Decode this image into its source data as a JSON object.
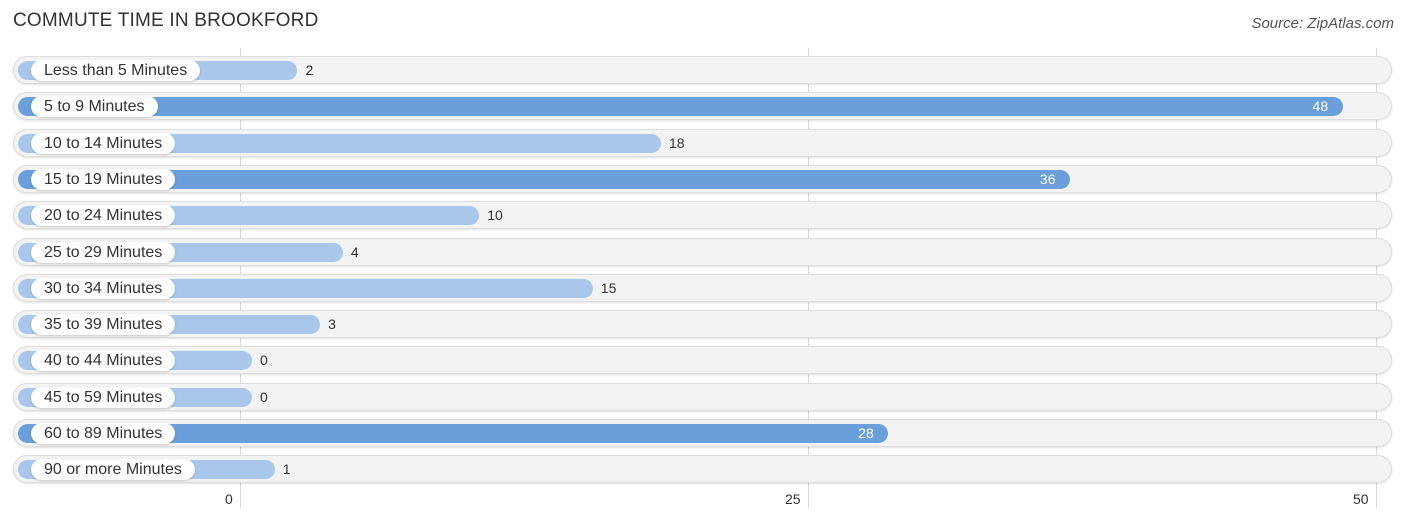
{
  "header": {
    "title": "COMMUTE TIME IN BROOKFORD",
    "source": "Source: ZipAtlas.com"
  },
  "colors": {
    "bar_strong": "#6a9fdb",
    "bar_light": "#a9c7ea",
    "row_bg": "#f3f3f3"
  },
  "chart_data": {
    "type": "bar",
    "orientation": "horizontal",
    "title": "COMMUTE TIME IN BROOKFORD",
    "xlabel": "",
    "ylabel": "",
    "categories": [
      "Less than 5 Minutes",
      "5 to 9 Minutes",
      "10 to 14 Minutes",
      "15 to 19 Minutes",
      "20 to 24 Minutes",
      "25 to 29 Minutes",
      "30 to 34 Minutes",
      "35 to 39 Minutes",
      "40 to 44 Minutes",
      "45 to 59 Minutes",
      "60 to 89 Minutes",
      "90 or more Minutes"
    ],
    "values": [
      2,
      48,
      18,
      36,
      10,
      4,
      15,
      3,
      0,
      0,
      28,
      1
    ],
    "value_labels": [
      "2",
      "48",
      "18",
      "36",
      "10",
      "4",
      "15",
      "3",
      "0",
      "0",
      "28",
      "1"
    ],
    "xlim": [
      0,
      50
    ],
    "xticks": [
      0,
      25,
      50
    ],
    "xtick_labels": [
      "0",
      "25",
      "50"
    ],
    "grid": true,
    "legend": "none",
    "source": "Source: ZipAtlas.com"
  }
}
